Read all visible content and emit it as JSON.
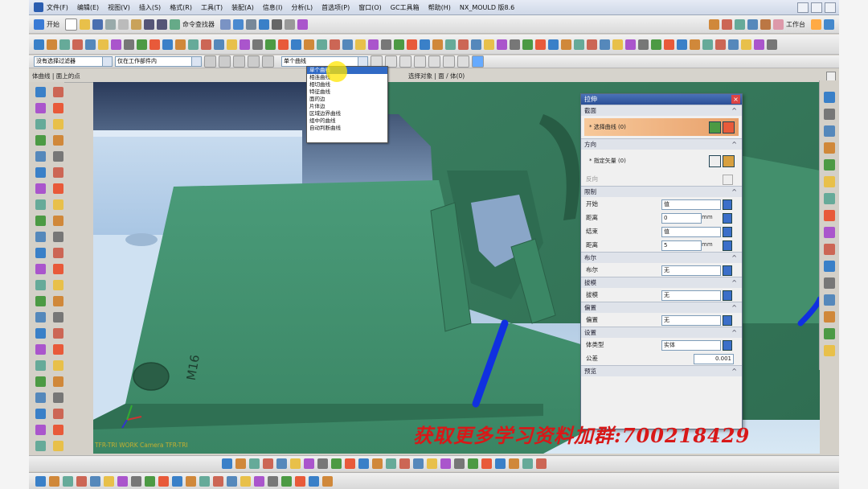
{
  "titlebar": {
    "menus": [
      "文件(F)",
      "编辑(E)",
      "视图(V)",
      "插入(S)",
      "格式(R)",
      "工具(T)",
      "装配(A)",
      "信息(I)",
      "分析(L)",
      "首选项(P)",
      "窗口(O)",
      "GC工具箱",
      "帮助(H)"
    ],
    "app_title": "NX_MOULD 版8.6"
  },
  "toolbar1": {
    "items": [
      "开始",
      "命令查找器",
      "工作台"
    ]
  },
  "toolbar3": {
    "filter_combo": "没有选择过滤器",
    "scope_combo": "仅在工作部件内",
    "snap_combo": "单个曲线"
  },
  "subheader": {
    "left_text": "体曲线 | 面上的点",
    "center_text": "选择对象 | 面 / 体(0)"
  },
  "dropdown": {
    "options": [
      "单个曲线",
      "相连曲线",
      "相切曲线",
      "特征曲线",
      "面的边",
      "片体边",
      "区域边界曲线",
      "组中的曲线",
      "自动判断曲线"
    ]
  },
  "dialog": {
    "title": "拉伸",
    "sections": {
      "section": "截面",
      "direction": "方向",
      "limits": "限制",
      "draft": "拔模",
      "offset": "偏置",
      "settings": "设置",
      "preview": "预览"
    },
    "select_curve": "* 选择曲线 (0)",
    "specify_vector": "* 指定矢量 (0)",
    "reverse": "反向",
    "limits": [
      {
        "label": "开始",
        "value": "值",
        "unit": ""
      },
      {
        "label": "距离",
        "value": "0",
        "unit": "mm"
      },
      {
        "label": "结束",
        "value": "值",
        "unit": ""
      },
      {
        "label": "距离",
        "value": "5",
        "unit": "mm"
      }
    ],
    "boolean": {
      "label": "布尔",
      "value": "无"
    },
    "draft": {
      "label": "拔模",
      "value": "无"
    },
    "offset": {
      "label": "偏置",
      "value": "无"
    },
    "settings": [
      {
        "label": "体类型",
        "value": "实体"
      },
      {
        "label": "公差",
        "value": "0.001"
      }
    ]
  },
  "model": {
    "label": "M16"
  },
  "camera_text": "TFR-TRI WORK Camera TFR-TRI",
  "watermark": "获取更多学习资料加群:700218429",
  "colors": {
    "model_green": "#3f8f6e",
    "curve_blue": "#1030e0",
    "watermark_red": "#d81818",
    "dialog_highlight": "#e8a06a"
  }
}
